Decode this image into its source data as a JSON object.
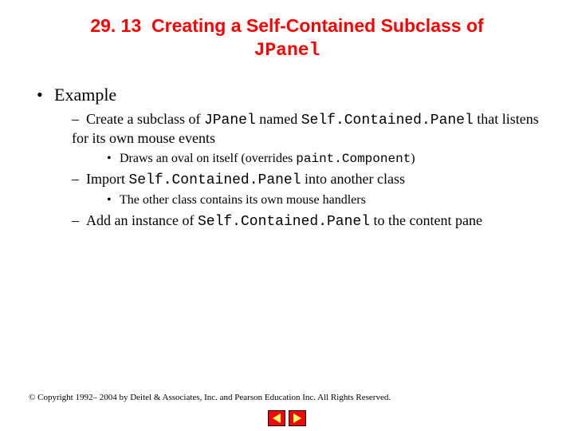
{
  "title": {
    "number": "29. 13",
    "text_a": "Creating a Self-Contained Subclass of",
    "code": "JPanel"
  },
  "bullets": {
    "l1_1": "Example",
    "l2_1_a": "Create a subclass of ",
    "l2_1_code1": "JPanel",
    "l2_1_b": " named ",
    "l2_1_code2": "Self.Contained.Panel",
    "l2_1_c": " that listens for its own mouse events",
    "l3_1_a": "Draws an oval on itself (overrides ",
    "l3_1_code": "paint.Component",
    "l3_1_b": ")",
    "l2_2_a": "Import ",
    "l2_2_code": "Self.Contained.Panel",
    "l2_2_b": " into another class",
    "l3_2": "The other class contains its own mouse handlers",
    "l2_3_a": "Add an instance of ",
    "l2_3_code": "Self.Contained.Panel",
    "l2_3_b": " to the content pane"
  },
  "footer": "© Copyright 1992– 2004 by Deitel & Associates, Inc. and Pearson Education Inc. All Rights Reserved."
}
